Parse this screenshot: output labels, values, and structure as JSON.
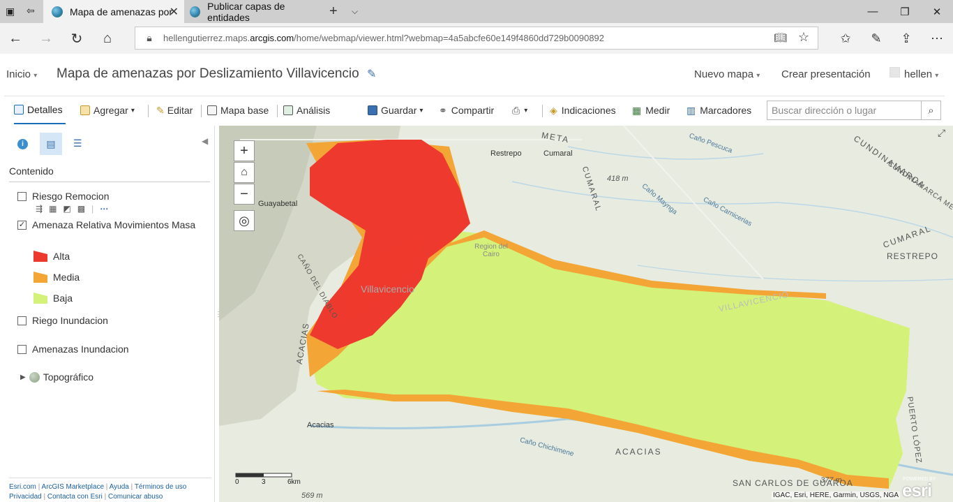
{
  "browser": {
    "tabs": [
      {
        "title": "Mapa de amenazas por"
      },
      {
        "title": "Publicar capas de entidades"
      }
    ],
    "url_domain_prefix": "hellengutierrez.maps.",
    "url_domain": "arcgis.com",
    "url_path": "/home/webmap/viewer.html?webmap=4a5abcfe60e149f4860dd729b0090892"
  },
  "header": {
    "home_label": "Inicio",
    "map_title": "Mapa de amenazas por Deslizamiento Villavicencio",
    "new_map_label": "Nuevo mapa",
    "create_presentation_label": "Crear presentación",
    "user_name": "hellen"
  },
  "toolbar": {
    "details_label": "Detalles",
    "add_label": "Agregar",
    "edit_label": "Editar",
    "basemap_label": "Mapa base",
    "analysis_label": "Análisis",
    "save_label": "Guardar",
    "share_label": "Compartir",
    "directions_label": "Indicaciones",
    "measure_label": "Medir",
    "bookmarks_label": "Marcadores",
    "search_placeholder": "Buscar dirección o lugar"
  },
  "sidebar": {
    "contents_heading": "Contenido",
    "layers": [
      {
        "name": "Riesgo Remocion",
        "checked": false
      },
      {
        "name": "Amenaza Relativa Movimientos Masa",
        "checked": true
      },
      {
        "name": "Riego Inundacion",
        "checked": false
      },
      {
        "name": "Amenazas Inundacion",
        "checked": false
      },
      {
        "name": "Topográfico",
        "checked": false
      }
    ],
    "legend": [
      {
        "label": "Alta",
        "color": "#ee3a2e"
      },
      {
        "label": "Media",
        "color": "#f3a536"
      },
      {
        "label": "Baja",
        "color": "#d4f27a"
      }
    ],
    "footer": {
      "line1": [
        "Esri.com",
        "ArcGIS Marketplace",
        "Ayuda",
        "Términos de uso"
      ],
      "line2": [
        "Privacidad",
        "Contacta con Esri",
        "Comunicar abuso"
      ]
    }
  },
  "map": {
    "labels": [
      "Guayabetal",
      "Restrepo",
      "Cumaral",
      "META",
      "CUMARAL",
      "CUNDINAMARCA",
      "CUNDINAMARCA META",
      "418 m",
      "Caño Pescuca",
      "Caño Maynga",
      "Caño Carnicerias",
      "CUMARAL",
      "RESTREPO",
      "Region del Cairo",
      "Villavicencio",
      "CAÑO DEL DIABLO",
      "VILLAVICENCIO",
      "ACACIAS",
      "Acacias",
      "ACACIAS",
      "Caño Chichimene",
      "SAN CARLOS DE GUAROA",
      "377 m",
      "569 m",
      "PUERTO LÓPEZ"
    ],
    "scale": {
      "ticks": [
        "0",
        "3",
        "6km"
      ]
    },
    "attribution": "IGAC, Esri, HERE, Garmin, USGS, NGA",
    "powered_by": "POWERED BY",
    "esri_logo": "esri"
  }
}
